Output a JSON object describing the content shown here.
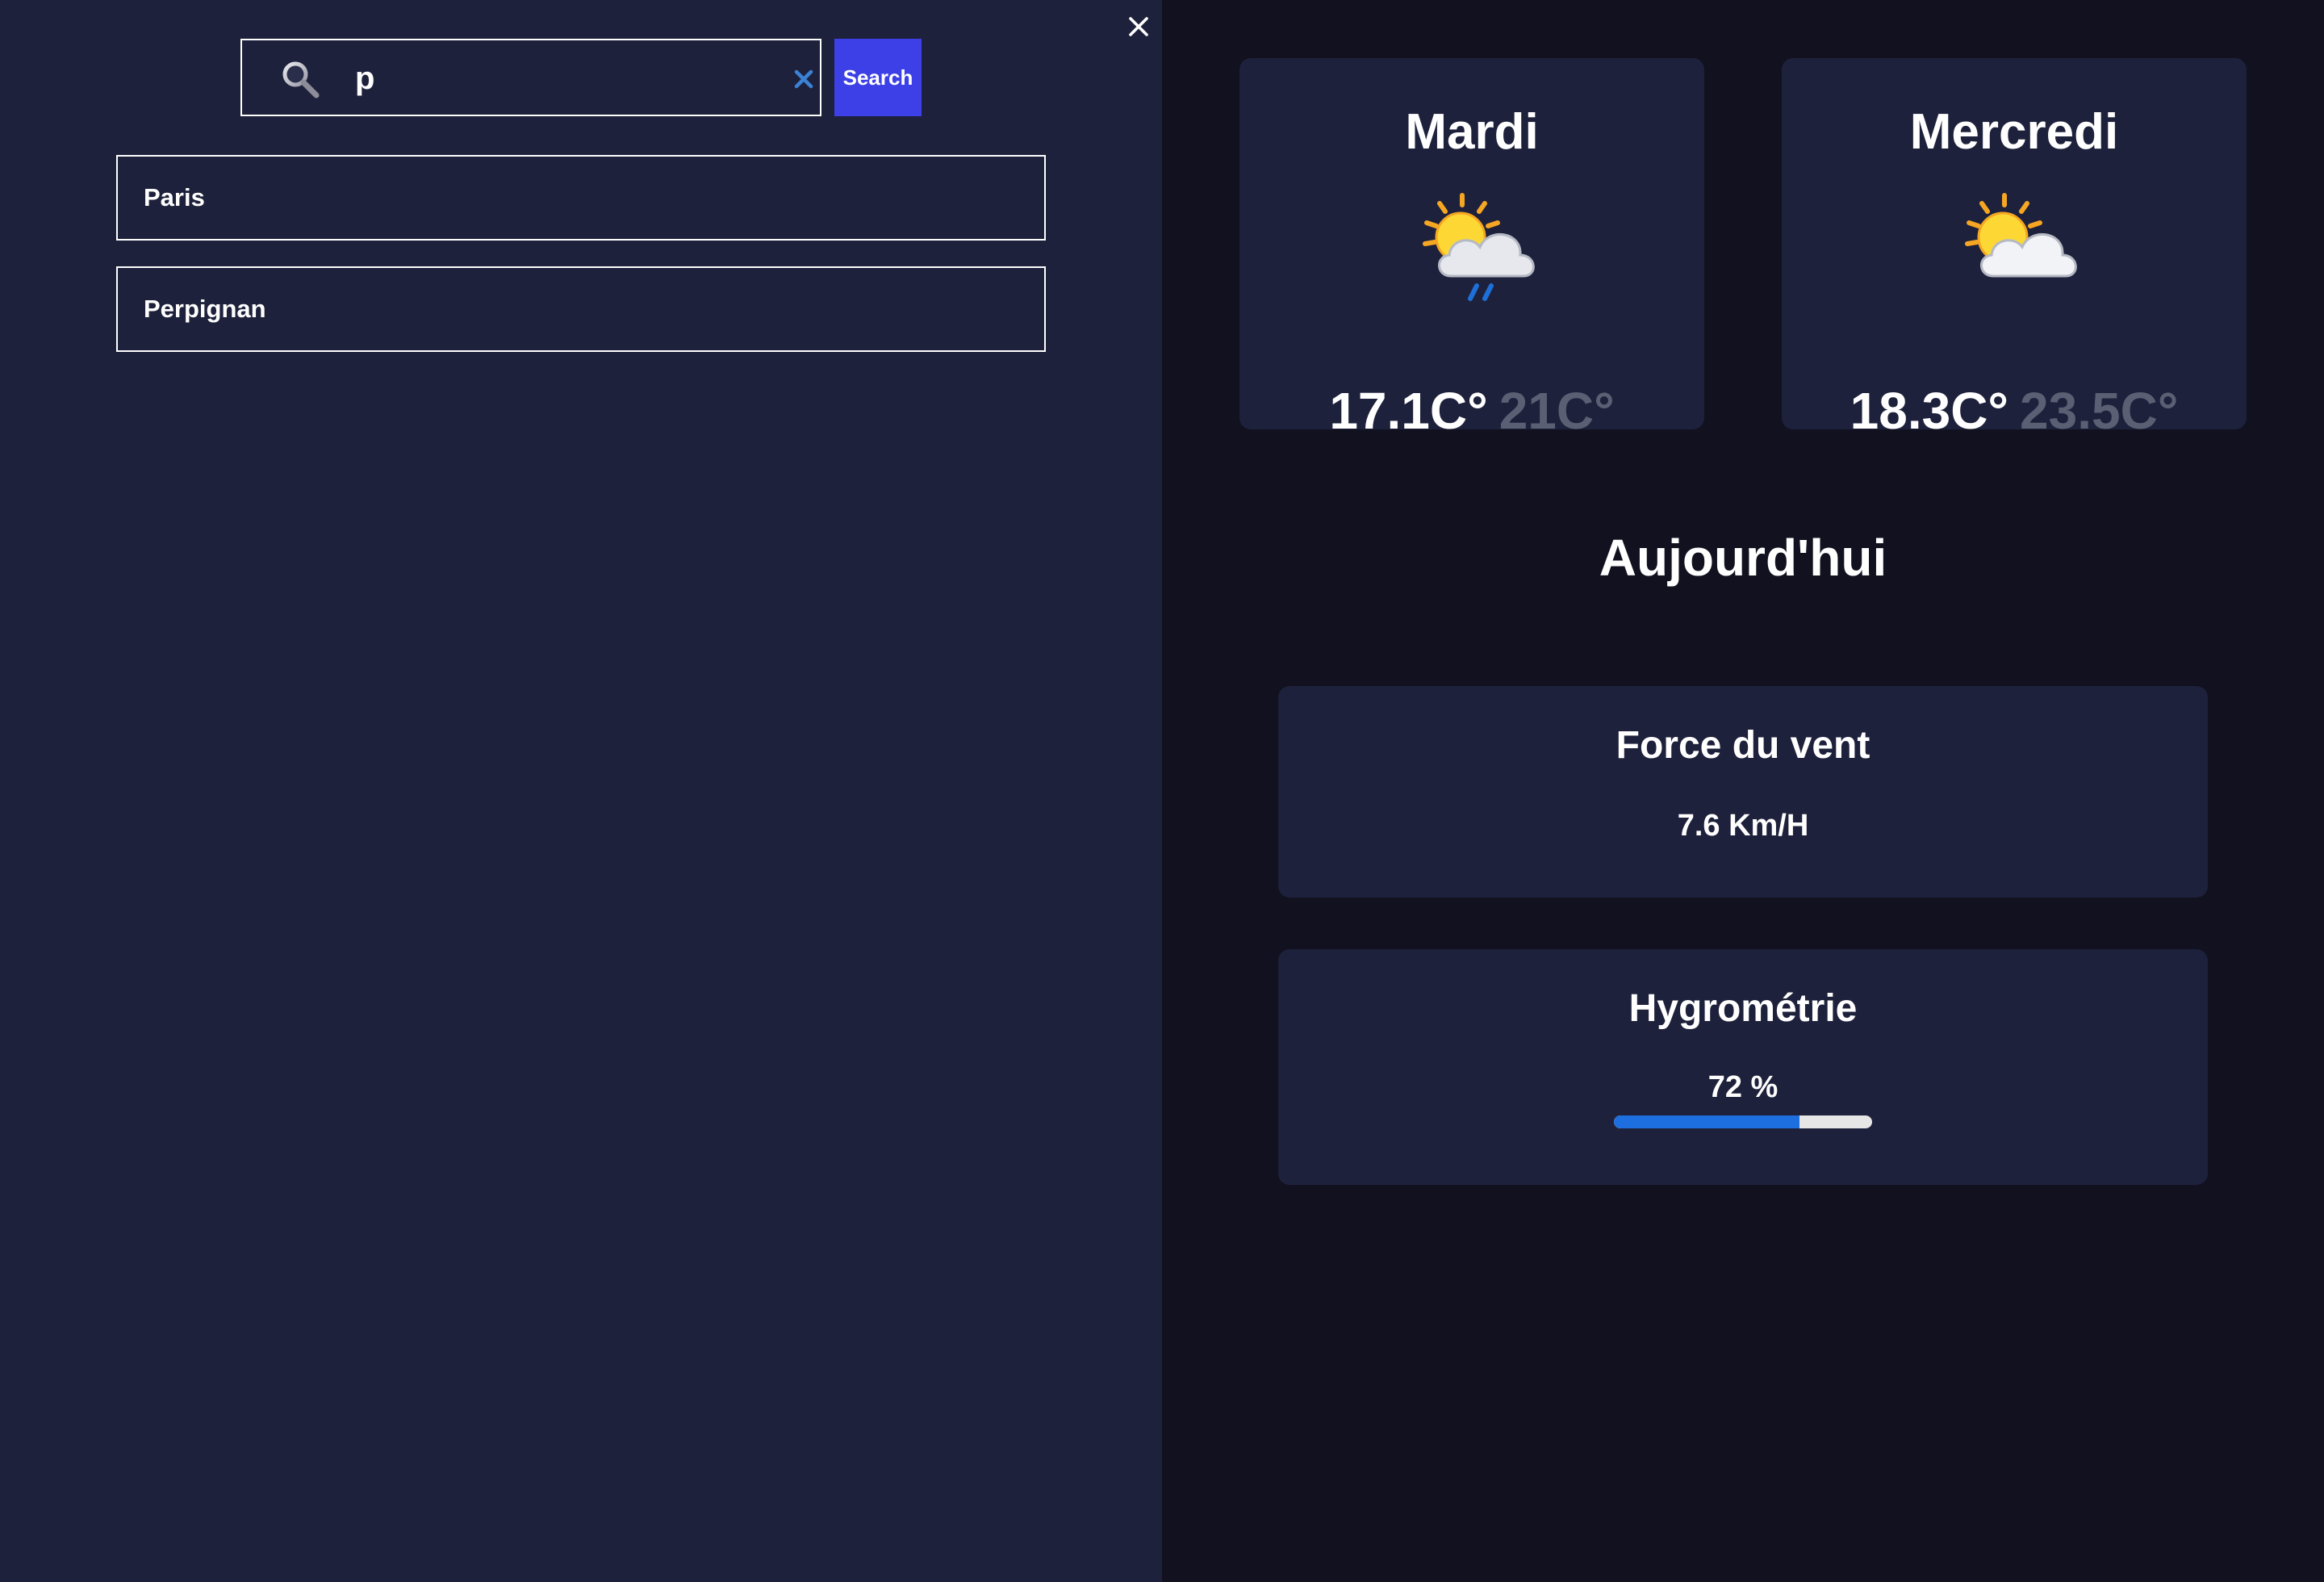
{
  "search": {
    "query": "p",
    "button_label": "Search",
    "icon": "search-icon",
    "clear_icon": "clear-icon"
  },
  "suggestions": [
    {
      "label": "Paris"
    },
    {
      "label": "Perpignan"
    }
  ],
  "close_icon": "close-icon",
  "forecast": [
    {
      "day": "Mardi",
      "icon": "sun-cloud-rain-icon",
      "temp_min": "17.1C°",
      "temp_max": "21C°"
    },
    {
      "day": "Mercredi",
      "icon": "sun-cloud-icon",
      "temp_min": "18.3C°",
      "temp_max": "23.5C°"
    }
  ],
  "today": {
    "title": "Aujourd'hui",
    "wind": {
      "title": "Force du vent",
      "value": "7.6 Km/H"
    },
    "humidity": {
      "title": "Hygrométrie",
      "value": "72 %",
      "percent": 72
    }
  },
  "colors": {
    "drawer_bg": "#1e213b",
    "page_bg": "#11111f",
    "card_bg": "#1e213b",
    "accent": "#3c40e6",
    "progress": "#1d6fe0",
    "muted_temp": "#5b5f74"
  }
}
